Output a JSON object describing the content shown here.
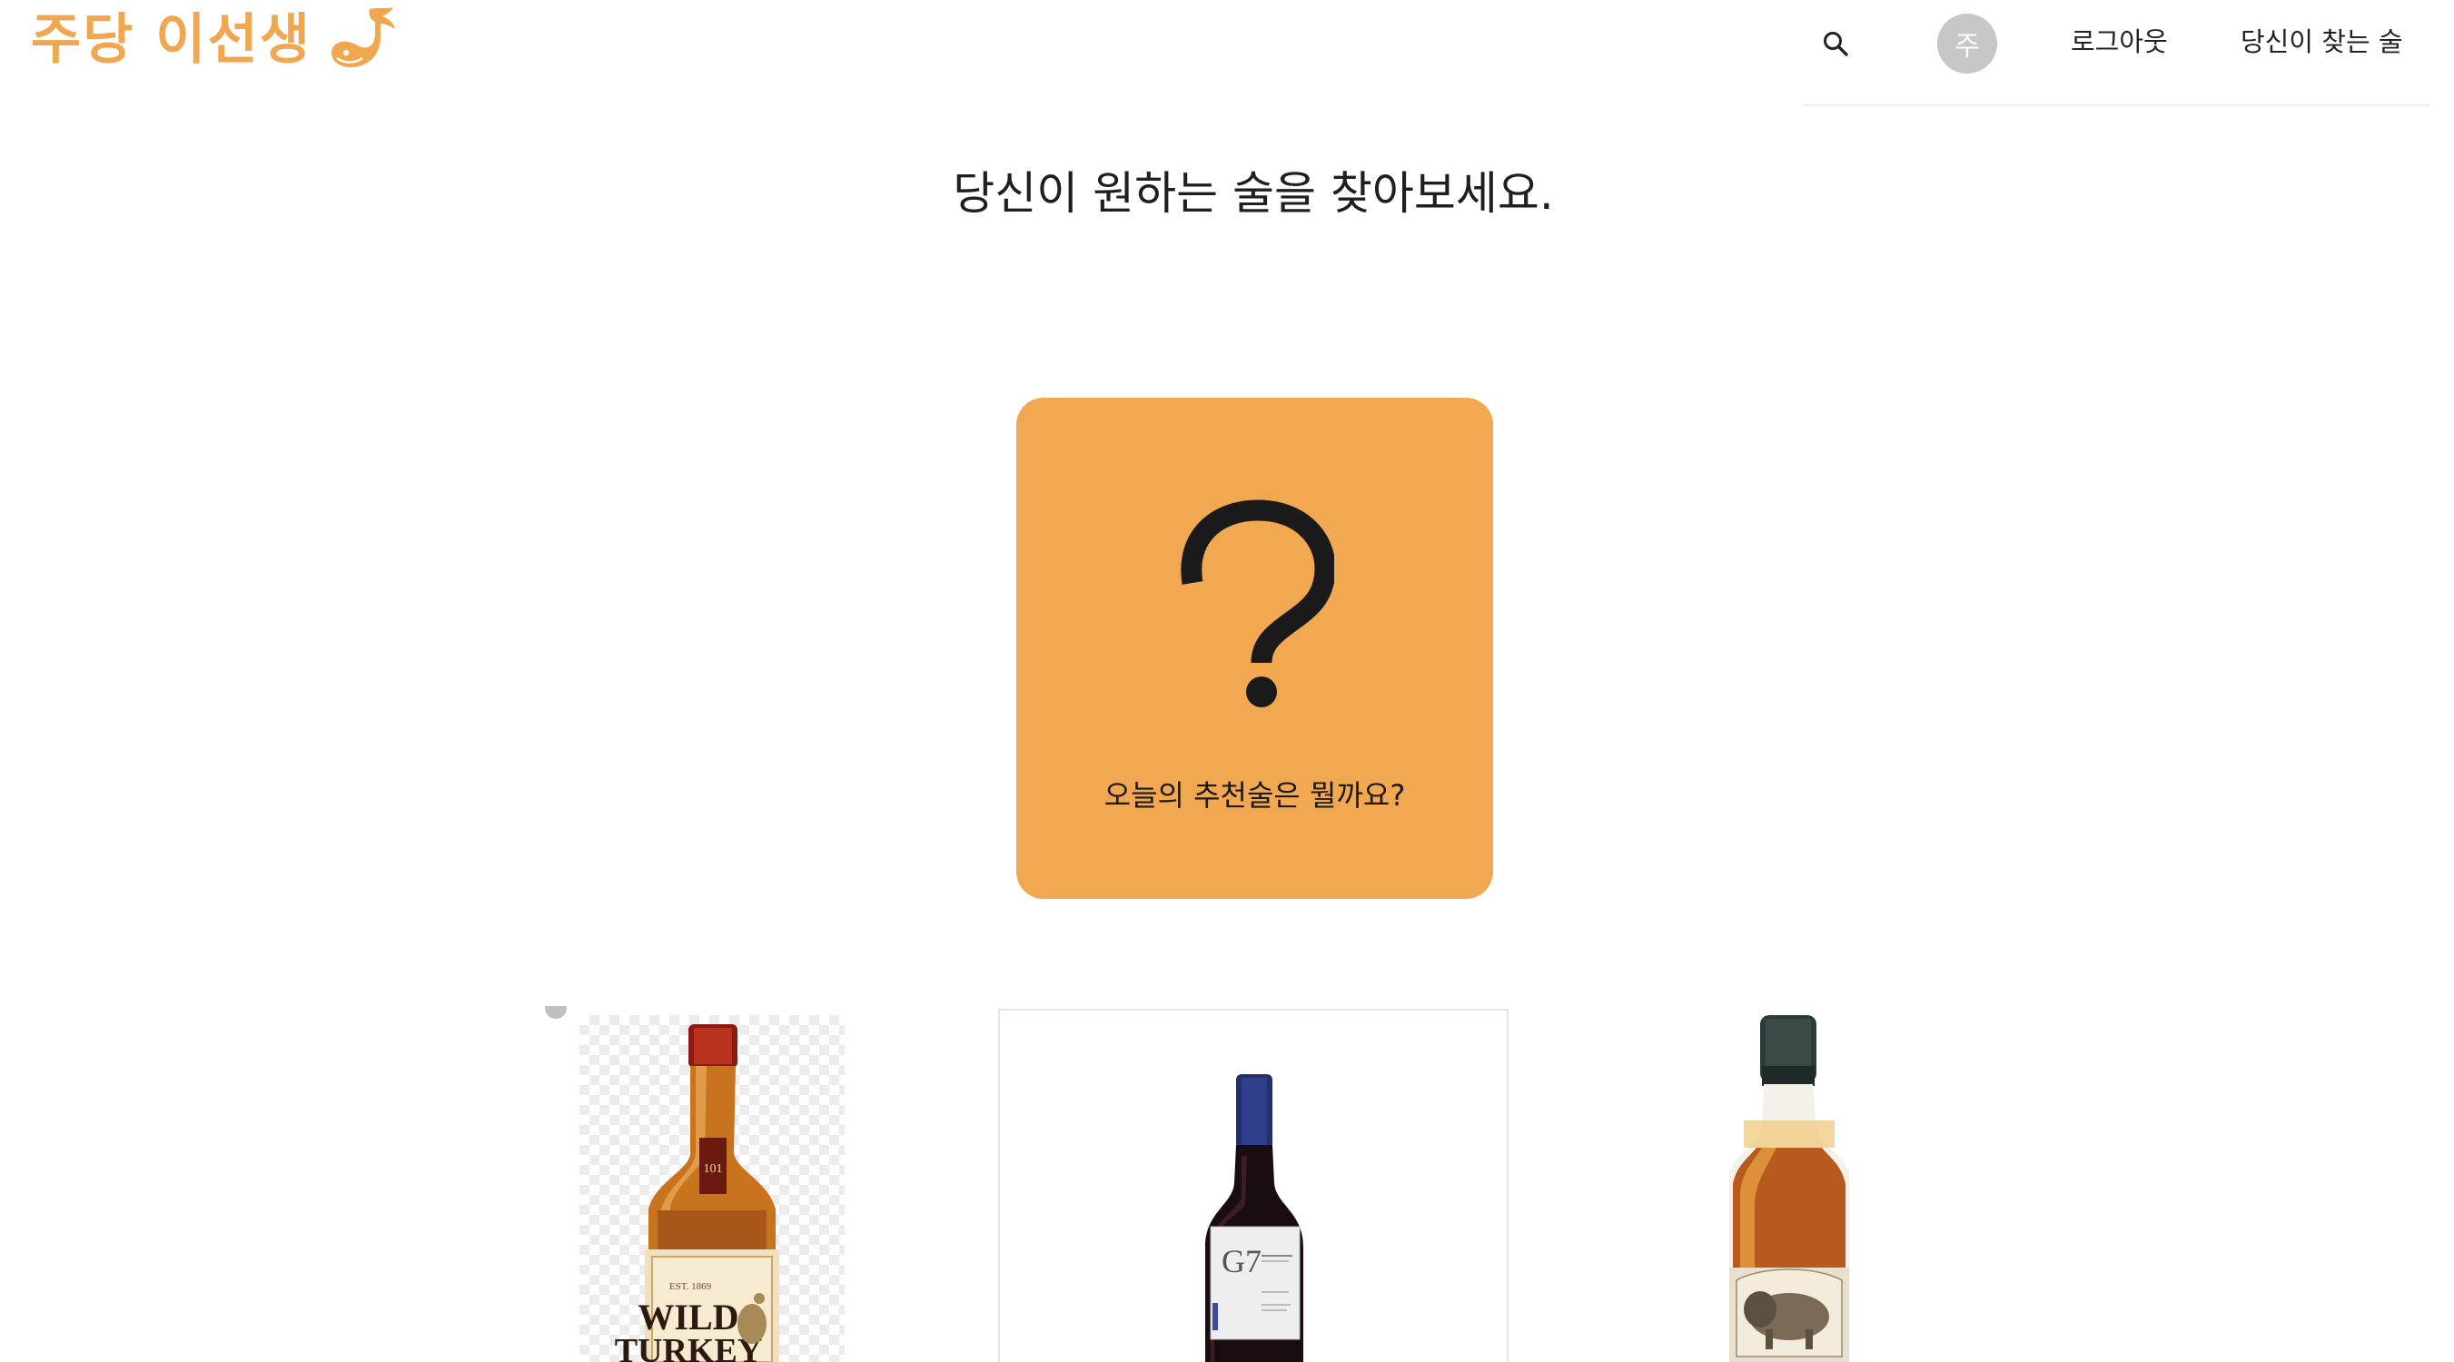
{
  "header": {
    "brand_name": "주당 이선생",
    "brand_icon": "whale-icon",
    "search_icon": "search-icon",
    "avatar_initial": "주",
    "logout_label": "로그아웃",
    "find_label": "당신이 찾는 술"
  },
  "main": {
    "headline": "당신이 원하는 술을 찾아보세요.",
    "recommendation": {
      "icon": "question-mark-icon",
      "caption": "오늘의 추천술은 뭘까요?",
      "color": "#F2A851"
    },
    "products": [
      {
        "name": "Wild Turkey 101 bourbon bottle",
        "label_line1": "WILD",
        "label_line2": "TURKEY",
        "neck_label": "101"
      },
      {
        "name": "G7 red wine bottle",
        "label_text": "G7"
      },
      {
        "name": "Buffalo Trace bourbon bottle"
      }
    ]
  },
  "colors": {
    "brand": "#F0A74F",
    "avatar_bg": "#c7c7c7"
  }
}
